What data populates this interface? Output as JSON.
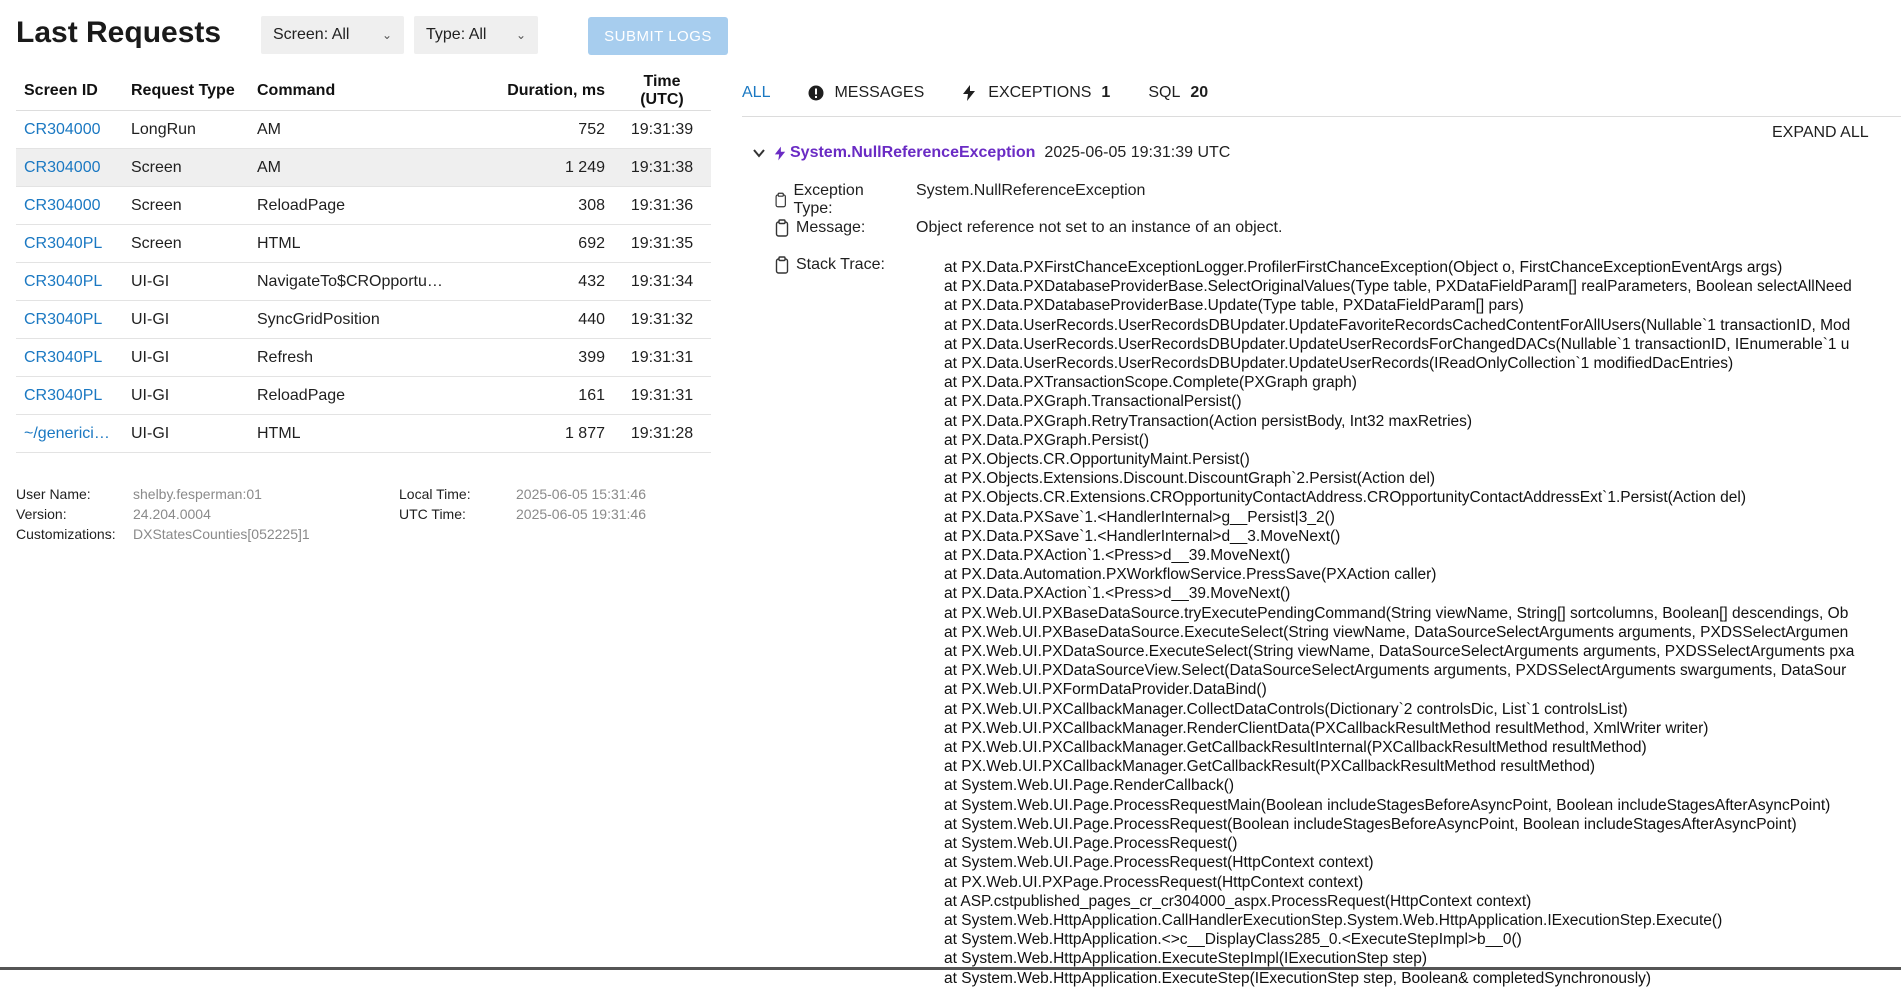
{
  "page": {
    "title": "Last Requests"
  },
  "filters": {
    "screen": "Screen: All",
    "type": "Type: All",
    "submit": "SUBMIT LOGS"
  },
  "table": {
    "headers": [
      "Screen ID",
      "Request Type",
      "Command",
      "Duration, ms",
      "Time (UTC)"
    ],
    "rows": [
      {
        "screen": "CR304000",
        "type": "LongRun",
        "command": "AM",
        "duration": "752",
        "time": "19:31:39"
      },
      {
        "screen": "CR304000",
        "type": "Screen",
        "command": "AM",
        "duration": "1 249",
        "time": "19:31:38"
      },
      {
        "screen": "CR304000",
        "type": "Screen",
        "command": "ReloadPage",
        "duration": "308",
        "time": "19:31:36"
      },
      {
        "screen": "CR3040PL",
        "type": "Screen",
        "command": "HTML",
        "duration": "692",
        "time": "19:31:35"
      },
      {
        "screen": "CR3040PL",
        "type": "UI-GI",
        "command": "NavigateTo$CROpportu…",
        "duration": "432",
        "time": "19:31:34"
      },
      {
        "screen": "CR3040PL",
        "type": "UI-GI",
        "command": "SyncGridPosition",
        "duration": "440",
        "time": "19:31:32"
      },
      {
        "screen": "CR3040PL",
        "type": "UI-GI",
        "command": "Refresh",
        "duration": "399",
        "time": "19:31:31"
      },
      {
        "screen": "CR3040PL",
        "type": "UI-GI",
        "command": "ReloadPage",
        "duration": "161",
        "time": "19:31:31"
      },
      {
        "screen": "~/generici…",
        "type": "UI-GI",
        "command": "HTML",
        "duration": "1 877",
        "time": "19:31:28"
      }
    ]
  },
  "info": {
    "user_label": "User Name:",
    "user": "shelby.fesperman:01",
    "version_label": "Version:",
    "version": "24.204.0004",
    "custom_label": "Customizations:",
    "custom": "DXStatesCounties[052225]1",
    "local_label": "Local Time:",
    "local": "2025-06-05 15:31:46",
    "utc_label": "UTC Time:",
    "utc": "2025-06-05 19:31:46"
  },
  "tabs": {
    "all": "ALL",
    "messages": "MESSAGES",
    "exceptions": "EXCEPTIONS",
    "exceptions_count": "1",
    "sql": "SQL",
    "sql_count": "20"
  },
  "expand_all": "EXPAND ALL",
  "exception": {
    "name": "System.NullReferenceException",
    "timestamp": "2025-06-05 19:31:39 UTC",
    "type_label": "Exception Type:",
    "type": "System.NullReferenceException",
    "message_label": "Message:",
    "message": "Object reference not set to an instance of an object.",
    "stack_label": "Stack Trace:",
    "stack": [
      "at PX.Data.PXFirstChanceExceptionLogger.ProfilerFirstChanceException(Object o, FirstChanceExceptionEventArgs args)",
      "at PX.Data.PXDatabaseProviderBase.SelectOriginalValues(Type table, PXDataFieldParam[] realParameters, Boolean selectAllNeed",
      "at PX.Data.PXDatabaseProviderBase.Update(Type table, PXDataFieldParam[] pars)",
      "at PX.Data.UserRecords.UserRecordsDBUpdater.UpdateFavoriteRecordsCachedContentForAllUsers(Nullable`1 transactionID, Mod",
      "at PX.Data.UserRecords.UserRecordsDBUpdater.UpdateUserRecordsForChangedDACs(Nullable`1 transactionID, IEnumerable`1 u",
      "at PX.Data.UserRecords.UserRecordsDBUpdater.UpdateUserRecords(IReadOnlyCollection`1 modifiedDacEntries)",
      "at PX.Data.PXTransactionScope.Complete(PXGraph graph)",
      "at PX.Data.PXGraph.TransactionalPersist()",
      "at PX.Data.PXGraph.RetryTransaction(Action persistBody, Int32 maxRetries)",
      "at PX.Data.PXGraph.Persist()",
      "at PX.Objects.CR.OpportunityMaint.Persist()",
      "at PX.Objects.Extensions.Discount.DiscountGraph`2.Persist(Action del)",
      "at PX.Objects.CR.Extensions.CROpportunityContactAddress.CROpportunityContactAddressExt`1.Persist(Action del)",
      "at PX.Data.PXSave`1.<HandlerInternal>g__Persist|3_2()",
      "at PX.Data.PXSave`1.<HandlerInternal>d__3.MoveNext()",
      "at PX.Data.PXAction`1.<Press>d__39.MoveNext()",
      "at PX.Data.Automation.PXWorkflowService.PressSave(PXAction caller)",
      "at PX.Data.PXAction`1.<Press>d__39.MoveNext()",
      "at PX.Web.UI.PXBaseDataSource.tryExecutePendingCommand(String viewName, String[] sortcolumns, Boolean[] descendings, Ob",
      "at PX.Web.UI.PXBaseDataSource.ExecuteSelect(String viewName, DataSourceSelectArguments arguments, PXDSSelectArgumen",
      "at PX.Web.UI.PXDataSource.ExecuteSelect(String viewName, DataSourceSelectArguments arguments, PXDSSelectArguments pxa",
      "at PX.Web.UI.PXDataSourceView.Select(DataSourceSelectArguments arguments, PXDSSelectArguments swarguments, DataSour",
      "at PX.Web.UI.PXFormDataProvider.DataBind()",
      "at PX.Web.UI.PXCallbackManager.CollectDataControls(Dictionary`2 controlsDic, List`1 controlsList)",
      "at PX.Web.UI.PXCallbackManager.RenderClientData(PXCallbackResultMethod resultMethod, XmlWriter writer)",
      "at PX.Web.UI.PXCallbackManager.GetCallbackResultInternal(PXCallbackResultMethod resultMethod)",
      "at PX.Web.UI.PXCallbackManager.GetCallbackResult(PXCallbackResultMethod resultMethod)",
      "at System.Web.UI.Page.RenderCallback()",
      "at System.Web.UI.Page.ProcessRequestMain(Boolean includeStagesBeforeAsyncPoint, Boolean includeStagesAfterAsyncPoint)",
      "at System.Web.UI.Page.ProcessRequest(Boolean includeStagesBeforeAsyncPoint, Boolean includeStagesAfterAsyncPoint)",
      "at System.Web.UI.Page.ProcessRequest()",
      "at System.Web.UI.Page.ProcessRequest(HttpContext context)",
      "at PX.Web.UI.PXPage.ProcessRequest(HttpContext context)",
      "at ASP.cstpublished_pages_cr_cr304000_aspx.ProcessRequest(HttpContext context)",
      "at System.Web.HttpApplication.CallHandlerExecutionStep.System.Web.HttpApplication.IExecutionStep.Execute()",
      "at System.Web.HttpApplication.<>c__DisplayClass285_0.<ExecuteStepImpl>b__0()",
      "at System.Web.HttpApplication.ExecuteStepImpl(IExecutionStep step)",
      "at System.Web.HttpApplication.ExecuteStep(IExecutionStep step, Boolean& completedSynchronously)"
    ]
  },
  "colors": {
    "link": "#1a78c2",
    "exception": "#6a2bc4",
    "submit_bg": "#a7cdee"
  }
}
